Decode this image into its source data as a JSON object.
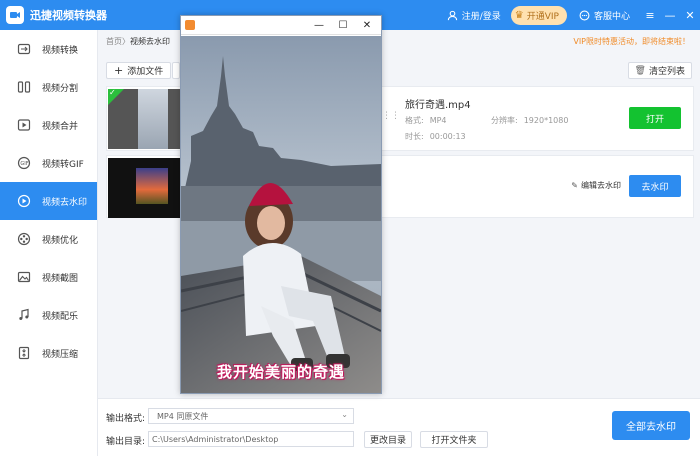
{
  "app": {
    "title": "迅捷视频转换器",
    "login": "注册/登录",
    "vip": "开通VIP",
    "service": "客服中心"
  },
  "sidebar": {
    "items": [
      {
        "label": "视频转换",
        "icon": "video-convert-icon"
      },
      {
        "label": "视频分割",
        "icon": "video-split-icon"
      },
      {
        "label": "视频合并",
        "icon": "video-merge-icon"
      },
      {
        "label": "视频转GIF",
        "icon": "gif-icon"
      },
      {
        "label": "视频去水印",
        "icon": "watermark-remove-icon",
        "active": true
      },
      {
        "label": "视频优化",
        "icon": "film-reel-icon"
      },
      {
        "label": "视频截图",
        "icon": "image-icon"
      },
      {
        "label": "视频配乐",
        "icon": "music-icon"
      },
      {
        "label": "视频压缩",
        "icon": "compress-icon"
      }
    ]
  },
  "breadcrumb": {
    "home": "首页",
    "sep": "〉",
    "current": "视频去水印"
  },
  "promo": "VIP限时特惠活动，即将结束啦！",
  "toolbar": {
    "add": "添加文件",
    "clear": "清空列表"
  },
  "files": [
    {
      "name": "旅行奇遇.mp4",
      "format_label": "格式:",
      "format": "MP4",
      "resolution_label": "分辨率:",
      "resolution": "1920*1080",
      "duration_label": "时长:",
      "duration": "00:00:13",
      "action": "打开"
    },
    {
      "edit": "编辑去水印",
      "action": "去水印"
    }
  ],
  "bottom": {
    "format_label": "输出格式:",
    "format_value": "MP4   同原文件",
    "dir_label": "输出目录:",
    "dir_value": "C:\\Users\\Administrator\\Desktop",
    "change_dir": "更改目录",
    "open_folder": "打开文件夹",
    "remove_all": "全部去水印"
  },
  "preview": {
    "subtitle": "我开始美丽的奇遇"
  },
  "colors": {
    "accent": "#2d8cf0",
    "green": "#13c230",
    "promo": "#f08c2a"
  }
}
